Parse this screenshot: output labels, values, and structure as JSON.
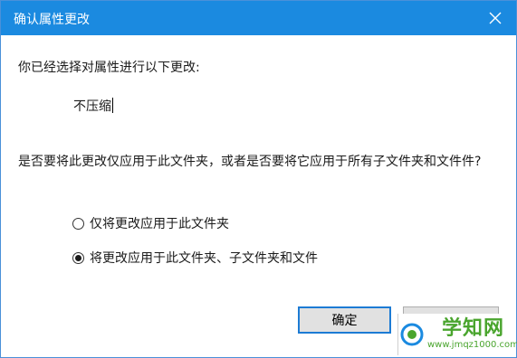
{
  "dialog": {
    "title": "确认属性更改",
    "prompt": "你已经选择对属性进行以下更改:",
    "attribute_change": "不压缩",
    "question": "是否要将此更改仅应用于此文件夹，或者是否要将它应用于所有子文件夹和文件件?",
    "options": [
      {
        "label": "仅将更改应用于此文件夹",
        "checked": false
      },
      {
        "label": "将更改应用于此文件夹、子文件夹和文件",
        "checked": true
      }
    ],
    "ok_label": "确定",
    "cancel_label": ""
  },
  "watermark": {
    "title": "学知网",
    "url": "www.jmqz1000.com"
  },
  "colors": {
    "titlebar": "#1b8ae0",
    "watermark": "#4aa52e"
  }
}
